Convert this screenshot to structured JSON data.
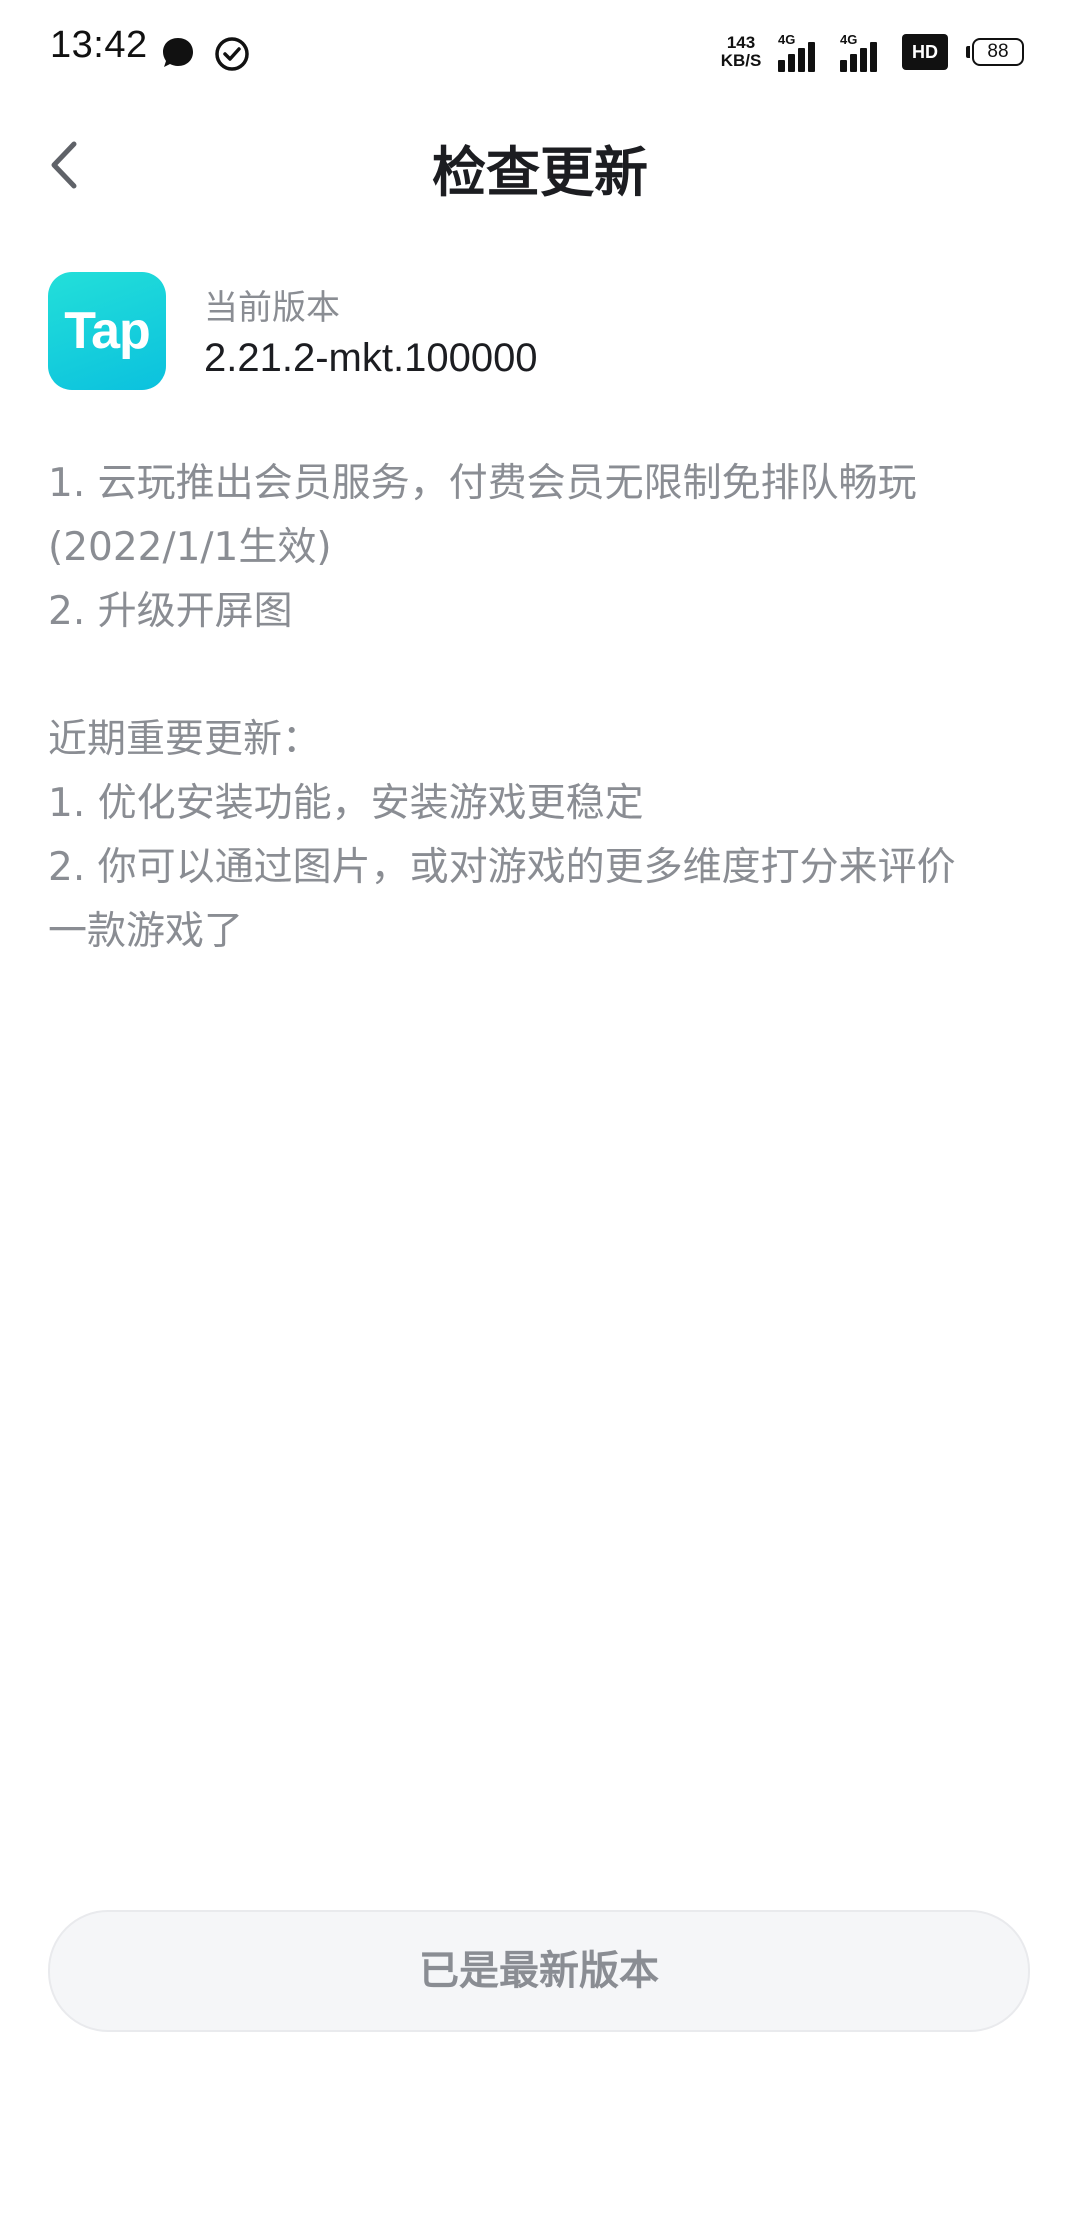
{
  "status_bar": {
    "time": "13:42",
    "net_speed_value": "143",
    "net_speed_unit": "KB/S",
    "signal_1_label": "4G",
    "signal_2_label": "4G",
    "hd_label": "HD",
    "battery_level": "88",
    "icons": [
      "chat-bubble-icon",
      "check-circle-icon",
      "signal-icon",
      "signal-icon",
      "hd-icon",
      "battery-icon"
    ]
  },
  "header": {
    "title": "检查更新",
    "back_icon": "chevron-left-icon"
  },
  "version": {
    "app_icon_text": "Tap",
    "label": "当前版本",
    "value": "2.21.2-mkt.100000",
    "brand_color_start": "#23dfd9",
    "brand_color_end": "#0bc1de"
  },
  "release_notes": {
    "line_1": "1. 云玩推出会员服务，付费会员无限制免排队畅玩",
    "line_2": "(2022/1/1生效)",
    "line_3": "2. 升级开屏图",
    "recent_heading": "近期重要更新：",
    "line_4": "1. 优化安装功能，安装游戏更稳定",
    "line_5": "2. 你可以通过图片，或对游戏的更多维度打分来评价",
    "line_6": "一款游戏了"
  },
  "footer": {
    "button_label": "已是最新版本"
  }
}
